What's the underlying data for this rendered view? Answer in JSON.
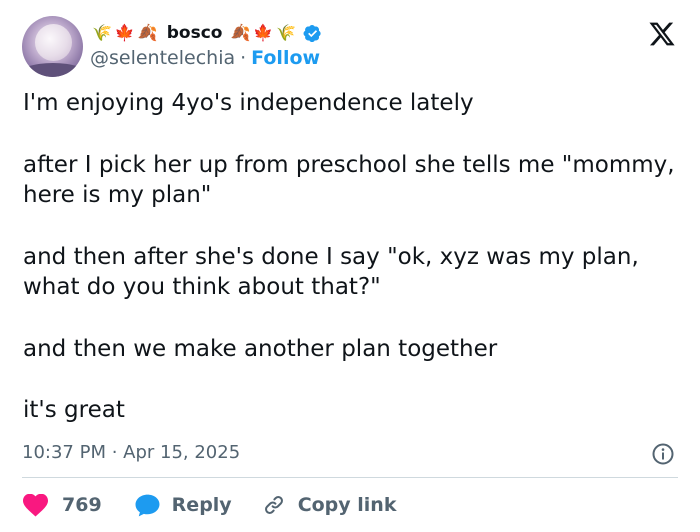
{
  "author": {
    "display_name": "bosco",
    "handle": "@selentelechia",
    "separator": "·",
    "follow_label": "Follow",
    "verified": true,
    "name_emojis_left": [
      "🌾",
      "🍁",
      "🍂"
    ],
    "name_emojis_right": [
      "🍂",
      "🍁",
      "🌾"
    ]
  },
  "tweet": {
    "paragraphs": [
      "I'm enjoying 4yo's independence lately",
      "after I pick her up from preschool she tells me \"mommy, here is my plan\"",
      "and then after she's done I say \"ok, xyz was my plan, what do you think about that?\"",
      "and then we make another plan together",
      "it's great"
    ],
    "timestamp": "10:37 PM · Apr 15, 2025"
  },
  "actions": {
    "like_count": "769",
    "reply_label": "Reply",
    "copy_link_label": "Copy link"
  },
  "icons": {
    "brand": "x-logo",
    "verified": "verified-badge-icon",
    "info": "info-icon",
    "like": "heart-icon",
    "reply": "speech-bubble-icon",
    "copy": "link-icon"
  },
  "colors": {
    "text": "#0f1419",
    "secondary": "#536471",
    "accent": "#1d9bf0",
    "like": "#f91880",
    "divider": "#cfd9de"
  }
}
